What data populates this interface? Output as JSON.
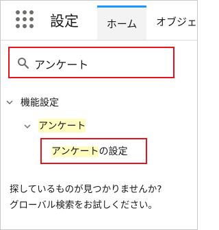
{
  "header": {
    "app_name": "設定",
    "tabs": [
      "ホーム",
      "オブジェクトマネージャ"
    ]
  },
  "search": {
    "value": "アンケート"
  },
  "tree": {
    "group_label": "機能設定",
    "node_label": "アンケート",
    "leaf_highlight": "アンケート",
    "leaf_rest": "の設定"
  },
  "no_result": {
    "line1": "探しているものが見つかりませんか?",
    "line2": "グローバル検索をお試しください。"
  },
  "colors": {
    "annotation_border": "#e5141c",
    "highlight": "#fffcc0",
    "active_tab_border": "#1b96ff"
  }
}
